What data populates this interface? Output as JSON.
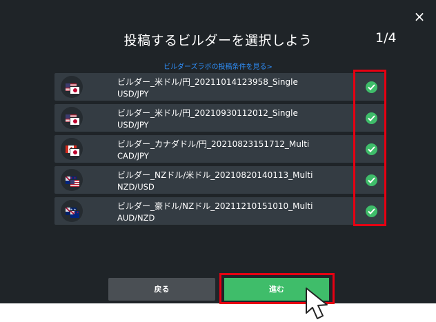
{
  "dialog": {
    "title": "投稿するビルダーを選択しよう",
    "step": "1/4",
    "condition_link": "ビルダーズラボの投稿条件を見る>",
    "close_icon": "×"
  },
  "builders": [
    {
      "name": "ビルダー_米ドル/円_20211014123958_Single",
      "pair": "USD/JPY",
      "flags": [
        "us",
        "jp"
      ],
      "checked": true
    },
    {
      "name": "ビルダー_米ドル/円_20210930112012_Single",
      "pair": "USD/JPY",
      "flags": [
        "us",
        "jp"
      ],
      "checked": true
    },
    {
      "name": "ビルダー_カナダドル/円_20210823151712_Multi",
      "pair": "CAD/JPY",
      "flags": [
        "ca",
        "jp"
      ],
      "checked": true
    },
    {
      "name": "ビルダー_NZドル/米ドル_20210820140113_Multi",
      "pair": "NZD/USD",
      "flags": [
        "nz",
        "us"
      ],
      "checked": true
    },
    {
      "name": "ビルダー_豪ドル/NZドル_20211210151010_Multi",
      "pair": "AUD/NZD",
      "flags": [
        "au",
        "nz"
      ],
      "checked": true
    }
  ],
  "buttons": {
    "back_label": "戻る",
    "next_label": "進む"
  },
  "colors": {
    "background": "#1f2428",
    "row": "#343c43",
    "accent_green": "#3fbd6a",
    "highlight_red": "#e60012",
    "link_blue": "#2f8ef8"
  }
}
